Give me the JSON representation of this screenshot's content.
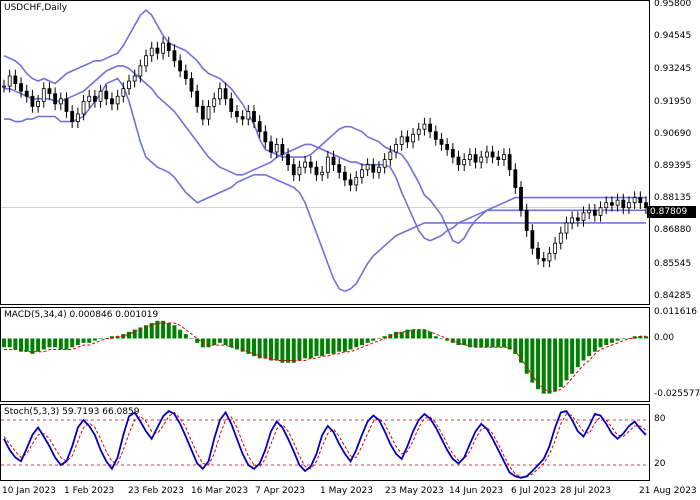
{
  "main_title": "USDCHF,Daily",
  "macd_label": "MACD(5,34,4) 0.000846 0.001019",
  "stoch_label": "Stoch(5,3,3) 59.7193 66.0859",
  "current_price": "0.87809",
  "colors": {
    "bands": "#7070e0",
    "candles": "#000000",
    "macd_hist": "#008000",
    "signal": "#e00000",
    "stoch_main": "#0000c0",
    "levels": "#c00000"
  },
  "chart_data": [
    {
      "type": "candlestick",
      "title": "USDCHF,Daily",
      "y_ticks": [
        "0.95800",
        "0.94545",
        "0.93245",
        "0.91950",
        "0.90690",
        "0.89395",
        "0.88135",
        "0.86880",
        "0.85545",
        "0.84285"
      ],
      "ylim": [
        0.84,
        0.96
      ],
      "x_ticks": [
        "10 Jan 2023",
        "1 Feb 2023",
        "23 Feb 2023",
        "16 Mar 2023",
        "7 Apr 2023",
        "1 May 2023",
        "23 May 2023",
        "14 Jun 2023",
        "6 Jul 2023",
        "28 Jul 2023",
        "21 Aug 2023"
      ],
      "close": [
        0.926,
        0.93,
        0.927,
        0.924,
        0.922,
        0.918,
        0.92,
        0.925,
        0.923,
        0.919,
        0.921,
        0.916,
        0.912,
        0.915,
        0.92,
        0.922,
        0.92,
        0.924,
        0.921,
        0.919,
        0.922,
        0.925,
        0.928,
        0.93,
        0.934,
        0.938,
        0.941,
        0.939,
        0.943,
        0.94,
        0.936,
        0.932,
        0.929,
        0.924,
        0.918,
        0.913,
        0.918,
        0.921,
        0.925,
        0.921,
        0.916,
        0.914,
        0.913,
        0.916,
        0.912,
        0.908,
        0.904,
        0.9,
        0.903,
        0.899,
        0.895,
        0.891,
        0.894,
        0.896,
        0.894,
        0.891,
        0.892,
        0.898,
        0.895,
        0.892,
        0.889,
        0.887,
        0.89,
        0.893,
        0.895,
        0.892,
        0.894,
        0.897,
        0.9,
        0.903,
        0.906,
        0.904,
        0.907,
        0.909,
        0.911,
        0.908,
        0.905,
        0.903,
        0.901,
        0.898,
        0.895,
        0.897,
        0.899,
        0.896,
        0.898,
        0.9,
        0.898,
        0.897,
        0.899,
        0.893,
        0.886,
        0.877,
        0.869,
        0.862,
        0.858,
        0.857,
        0.86,
        0.864,
        0.868,
        0.872,
        0.874,
        0.873,
        0.876,
        0.877,
        0.875,
        0.878,
        0.88,
        0.879,
        0.881,
        0.878,
        0.88,
        0.882,
        0.88,
        0.878
      ],
      "bands": {
        "upper": [
          0.938,
          0.937,
          0.936,
          0.934,
          0.931,
          0.929,
          0.928,
          0.929,
          0.928,
          0.927,
          0.929,
          0.931,
          0.932,
          0.933,
          0.934,
          0.935,
          0.936,
          0.936,
          0.937,
          0.938,
          0.939,
          0.942,
          0.946,
          0.95,
          0.954,
          0.956,
          0.954,
          0.95,
          0.946,
          0.943,
          0.942,
          0.941,
          0.94,
          0.938,
          0.936,
          0.933,
          0.931,
          0.93,
          0.929,
          0.927,
          0.925,
          0.922,
          0.919,
          0.915,
          0.911,
          0.905,
          0.901,
          0.9,
          0.899,
          0.898,
          0.898,
          0.898,
          0.898,
          0.898,
          0.899,
          0.901,
          0.903,
          0.905,
          0.907,
          0.909,
          0.91,
          0.91,
          0.909,
          0.908,
          0.906,
          0.905,
          0.904,
          0.902,
          0.901,
          0.9,
          0.899,
          0.896,
          0.892,
          0.888,
          0.883,
          0.881,
          0.878,
          0.875,
          0.87,
          0.865,
          0.864,
          0.866,
          0.87,
          0.873,
          0.875,
          0.877,
          0.878,
          0.879,
          0.88,
          0.881,
          0.882,
          0.882,
          0.882,
          0.882,
          0.882,
          0.882,
          0.882,
          0.882,
          0.882,
          0.882,
          0.882,
          0.882,
          0.882,
          0.882,
          0.882,
          0.882,
          0.882,
          0.882,
          0.882,
          0.882,
          0.882,
          0.882,
          0.882,
          0.882
        ],
        "middle": [
          0.925,
          0.925,
          0.924,
          0.923,
          0.922,
          0.921,
          0.921,
          0.921,
          0.921,
          0.92,
          0.92,
          0.921,
          0.922,
          0.923,
          0.924,
          0.926,
          0.928,
          0.93,
          0.932,
          0.933,
          0.934,
          0.934,
          0.933,
          0.931,
          0.929,
          0.927,
          0.925,
          0.922,
          0.92,
          0.918,
          0.916,
          0.913,
          0.91,
          0.907,
          0.904,
          0.901,
          0.898,
          0.896,
          0.894,
          0.893,
          0.892,
          0.891,
          0.891,
          0.892,
          0.893,
          0.894,
          0.895,
          0.896,
          0.898,
          0.899,
          0.9,
          0.901,
          0.902,
          0.903,
          0.903,
          0.902,
          0.901,
          0.9,
          0.899,
          0.898,
          0.897,
          0.896,
          0.896,
          0.895,
          0.895,
          0.895,
          0.895,
          0.895,
          0.894,
          0.89,
          0.884,
          0.879,
          0.874,
          0.869,
          0.866,
          0.865,
          0.866,
          0.867,
          0.869,
          0.87,
          0.872,
          0.873,
          0.874,
          0.875,
          0.876,
          0.877,
          0.877,
          0.877,
          0.877,
          0.877,
          0.877,
          0.877,
          0.877,
          0.877,
          0.877,
          0.877,
          0.877,
          0.877,
          0.877,
          0.877,
          0.877,
          0.877,
          0.877,
          0.877,
          0.877,
          0.877,
          0.877,
          0.877,
          0.877,
          0.877,
          0.877,
          0.877,
          0.877,
          0.877
        ],
        "lower": [
          0.913,
          0.913,
          0.912,
          0.912,
          0.913,
          0.913,
          0.914,
          0.914,
          0.914,
          0.914,
          0.912,
          0.912,
          0.912,
          0.913,
          0.914,
          0.917,
          0.92,
          0.923,
          0.927,
          0.928,
          0.929,
          0.926,
          0.92,
          0.912,
          0.904,
          0.898,
          0.896,
          0.894,
          0.893,
          0.892,
          0.89,
          0.887,
          0.884,
          0.882,
          0.88,
          0.881,
          0.882,
          0.883,
          0.884,
          0.885,
          0.886,
          0.888,
          0.889,
          0.89,
          0.891,
          0.891,
          0.891,
          0.89,
          0.889,
          0.888,
          0.887,
          0.886,
          0.884,
          0.88,
          0.874,
          0.868,
          0.862,
          0.856,
          0.85,
          0.846,
          0.845,
          0.846,
          0.848,
          0.852,
          0.856,
          0.859,
          0.861,
          0.863,
          0.865,
          0.867,
          0.868,
          0.869,
          0.87,
          0.871,
          0.872,
          0.872,
          0.872,
          0.872,
          0.872,
          0.872,
          0.872,
          0.872,
          0.872,
          0.872,
          0.872,
          0.872,
          0.872,
          0.872,
          0.872,
          0.872,
          0.872,
          0.872,
          0.872,
          0.872,
          0.872,
          0.872,
          0.872,
          0.872,
          0.872,
          0.872,
          0.872,
          0.872,
          0.872,
          0.872,
          0.872,
          0.872,
          0.872,
          0.872,
          0.872,
          0.872,
          0.872,
          0.872,
          0.872,
          0.872
        ]
      }
    },
    {
      "type": "bar",
      "title": "MACD(5,34,4) 0.000846 0.001019",
      "y_ticks": [
        "0.011616",
        "0.00",
        "-0.025577"
      ],
      "ylim": [
        -0.027,
        0.012
      ],
      "histogram": [
        -0.004,
        -0.004,
        -0.005,
        -0.006,
        -0.006,
        -0.007,
        -0.006,
        -0.005,
        -0.004,
        -0.004,
        -0.005,
        -0.005,
        -0.004,
        -0.003,
        -0.002,
        -0.002,
        -0.001,
        0.0,
        0.0,
        0.001,
        0.001,
        0.002,
        0.003,
        0.004,
        0.005,
        0.006,
        0.007,
        0.008,
        0.008,
        0.007,
        0.006,
        0.004,
        0.002,
        0.0,
        -0.002,
        -0.004,
        -0.004,
        -0.003,
        -0.002,
        -0.003,
        -0.004,
        -0.005,
        -0.006,
        -0.007,
        -0.008,
        -0.009,
        -0.009,
        -0.01,
        -0.01,
        -0.011,
        -0.011,
        -0.011,
        -0.01,
        -0.009,
        -0.009,
        -0.008,
        -0.008,
        -0.007,
        -0.007,
        -0.006,
        -0.006,
        -0.005,
        -0.004,
        -0.003,
        -0.002,
        -0.001,
        0.0,
        0.001,
        0.002,
        0.003,
        0.003,
        0.004,
        0.004,
        0.004,
        0.004,
        0.003,
        0.001,
        0.0,
        -0.001,
        -0.002,
        -0.003,
        -0.003,
        -0.004,
        -0.004,
        -0.004,
        -0.004,
        -0.004,
        -0.004,
        -0.004,
        -0.005,
        -0.007,
        -0.011,
        -0.016,
        -0.02,
        -0.023,
        -0.025,
        -0.025,
        -0.024,
        -0.022,
        -0.019,
        -0.016,
        -0.013,
        -0.01,
        -0.008,
        -0.006,
        -0.004,
        -0.003,
        -0.002,
        -0.001,
        0.0,
        0.0,
        0.001,
        0.001,
        0.001
      ],
      "signal": [
        -0.005,
        -0.005,
        -0.005,
        -0.005,
        -0.006,
        -0.006,
        -0.006,
        -0.006,
        -0.005,
        -0.005,
        -0.005,
        -0.005,
        -0.005,
        -0.004,
        -0.003,
        -0.003,
        -0.002,
        -0.001,
        0.0,
        0.0,
        0.001,
        0.001,
        0.002,
        0.003,
        0.004,
        0.005,
        0.006,
        0.007,
        0.007,
        0.007,
        0.007,
        0.006,
        0.004,
        0.002,
        0.0,
        -0.002,
        -0.003,
        -0.003,
        -0.003,
        -0.003,
        -0.004,
        -0.004,
        -0.005,
        -0.006,
        -0.007,
        -0.008,
        -0.009,
        -0.009,
        -0.01,
        -0.01,
        -0.01,
        -0.01,
        -0.01,
        -0.01,
        -0.009,
        -0.009,
        -0.008,
        -0.008,
        -0.007,
        -0.007,
        -0.006,
        -0.006,
        -0.005,
        -0.004,
        -0.003,
        -0.002,
        -0.001,
        0.0,
        0.001,
        0.002,
        0.003,
        0.003,
        0.004,
        0.004,
        0.004,
        0.003,
        0.002,
        0.001,
        0.0,
        -0.001,
        -0.002,
        -0.003,
        -0.003,
        -0.004,
        -0.004,
        -0.004,
        -0.004,
        -0.004,
        -0.004,
        -0.004,
        -0.006,
        -0.009,
        -0.013,
        -0.017,
        -0.02,
        -0.023,
        -0.024,
        -0.024,
        -0.023,
        -0.021,
        -0.018,
        -0.015,
        -0.012,
        -0.01,
        -0.007,
        -0.005,
        -0.004,
        -0.003,
        -0.002,
        -0.001,
        0.0,
        0.0,
        0.001,
        0.001
      ]
    },
    {
      "type": "line",
      "title": "Stoch(5,3,3) 59.7193 66.0859",
      "y_ticks": [
        "80",
        "20"
      ],
      "ylim": [
        0,
        100
      ],
      "levels": [
        80,
        20
      ],
      "series": [
        {
          "values": [
            55,
            40,
            30,
            25,
            42,
            60,
            70,
            58,
            45,
            30,
            20,
            25,
            45,
            70,
            80,
            72,
            60,
            40,
            25,
            15,
            30,
            60,
            85,
            90,
            78,
            65,
            55,
            70,
            85,
            92,
            88,
            75,
            58,
            40,
            22,
            15,
            25,
            55,
            80,
            90,
            75,
            55,
            35,
            20,
            15,
            22,
            40,
            65,
            78,
            70,
            55,
            38,
            20,
            12,
            18,
            35,
            60,
            72,
            64,
            48,
            35,
            25,
            40,
            60,
            78,
            86,
            80,
            65,
            48,
            35,
            28,
            45,
            65,
            80,
            88,
            82,
            70,
            55,
            40,
            28,
            22,
            30,
            48,
            65,
            75,
            68,
            55,
            40,
            25,
            10,
            5,
            3,
            5,
            12,
            20,
            28,
            45,
            70,
            90,
            92,
            80,
            65,
            58,
            72,
            88,
            86,
            75,
            62,
            55,
            62,
            72,
            78,
            68,
            60
          ]
        },
        {
          "values": [
            58,
            48,
            38,
            30,
            35,
            48,
            60,
            62,
            55,
            42,
            30,
            25,
            32,
            52,
            70,
            76,
            70,
            55,
            38,
            25,
            22,
            40,
            62,
            80,
            85,
            78,
            65,
            62,
            72,
            85,
            90,
            82,
            70,
            52,
            35,
            22,
            20,
            35,
            60,
            80,
            84,
            70,
            50,
            32,
            20,
            18,
            28,
            48,
            68,
            74,
            65,
            50,
            32,
            18,
            15,
            25,
            45,
            62,
            68,
            58,
            45,
            32,
            30,
            45,
            62,
            78,
            82,
            75,
            60,
            45,
            35,
            38,
            52,
            70,
            82,
            84,
            76,
            63,
            48,
            35,
            26,
            28,
            38,
            55,
            68,
            70,
            62,
            48,
            32,
            18,
            8,
            4,
            4,
            8,
            15,
            22,
            34,
            52,
            75,
            88,
            86,
            75,
            65,
            62,
            76,
            84,
            80,
            70,
            60,
            58,
            65,
            72,
            72,
            66
          ]
        }
      ]
    }
  ]
}
